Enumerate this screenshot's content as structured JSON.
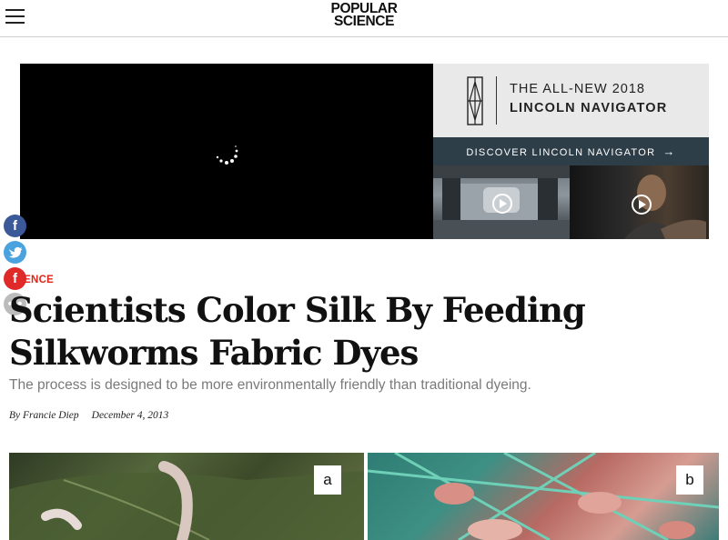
{
  "header": {
    "logo_line1": "POPULAR",
    "logo_line2": "SCIENCE"
  },
  "ad": {
    "line1": "THE ALL-NEW 2018",
    "line2": "LINCOLN NAVIGATOR",
    "cta": "DISCOVER LINCOLN NAVIGATOR",
    "cta_arrow": "→"
  },
  "share": {
    "facebook": "f",
    "flipboard": "f",
    "more": "•••"
  },
  "article": {
    "category": "ENCE",
    "headline": "Scientists Color Silk By Feeding Silkworms Fabric Dyes",
    "dek": "The process is designed to be more environmentally friendly than traditional dyeing.",
    "byline": "By Francie Diep",
    "date": "December 4, 2013"
  },
  "figure": {
    "label_a": "a",
    "label_b": "b"
  },
  "colors": {
    "accent": "#e0251b",
    "ad_cta_bg": "#2e3e48",
    "facebook": "#3b5998",
    "twitter": "#4aa3df",
    "flipboard": "#e02a2a"
  }
}
